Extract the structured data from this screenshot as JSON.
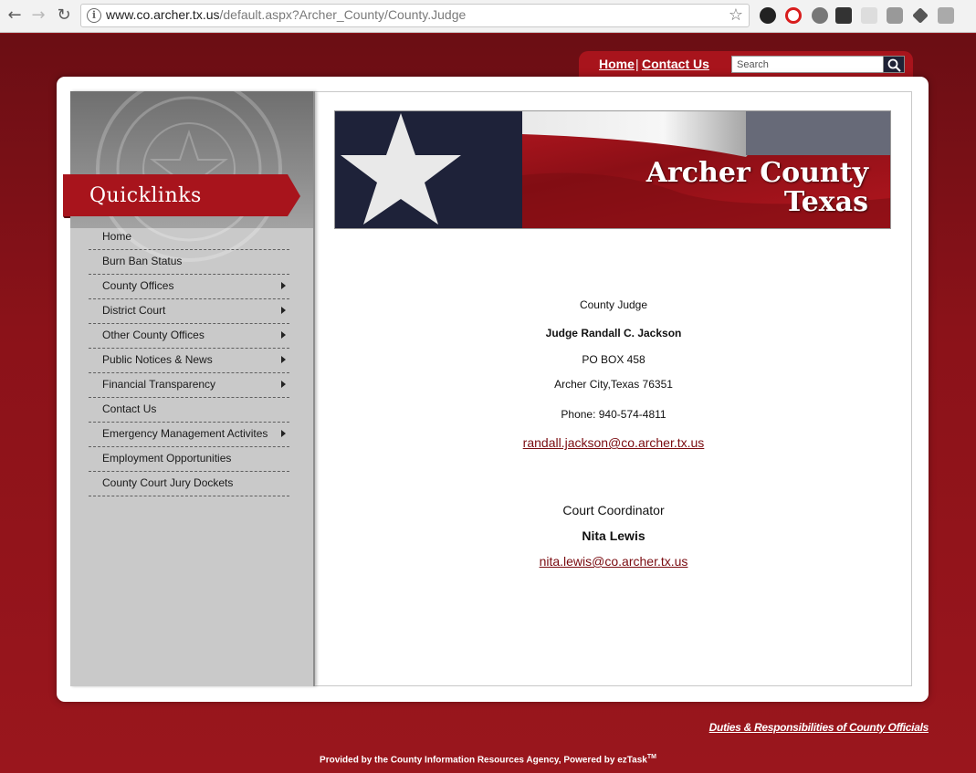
{
  "browser": {
    "url_host": "www.co.archer.tx.us",
    "url_path": "/default.aspx?Archer_County/County.Judge",
    "back_icon": "←",
    "forward_icon": "→",
    "reload_icon": "↻",
    "info_icon": "i",
    "star_icon": "☆"
  },
  "topnav": {
    "home_label": "Home",
    "separator": "|",
    "contact_label": "Contact Us",
    "search_placeholder": "Search"
  },
  "sidebar": {
    "title": "Quicklinks",
    "items": [
      {
        "label": "Home",
        "has_submenu": false
      },
      {
        "label": "Burn Ban Status",
        "has_submenu": false
      },
      {
        "label": "County Offices",
        "has_submenu": true
      },
      {
        "label": "District Court",
        "has_submenu": true
      },
      {
        "label": "Other County Offices",
        "has_submenu": true
      },
      {
        "label": "Public Notices & News",
        "has_submenu": true
      },
      {
        "label": "Financial Transparency",
        "has_submenu": true
      },
      {
        "label": "Contact Us",
        "has_submenu": false
      },
      {
        "label": "Emergency Management Activites",
        "has_submenu": true
      },
      {
        "label": "Employment Opportunities",
        "has_submenu": false
      },
      {
        "label": "County Court Jury Dockets",
        "has_submenu": false
      }
    ]
  },
  "banner": {
    "line1": "Archer County",
    "line2": "Texas"
  },
  "content": {
    "office": "County Judge",
    "name": "Judge Randall C. Jackson",
    "address1": "PO BOX 458",
    "address2": "Archer City,Texas 76351",
    "phone": "Phone: 940-574-4811",
    "email": "randall.jackson@co.archer.tx.us",
    "coord_title": "Court Coordinator",
    "coord_name": "Nita Lewis",
    "coord_email": "nita.lewis@co.archer.tx.us"
  },
  "footer": {
    "duties_link": "Duties & Responsibilities of County Officials",
    "provided_text": "Provided by the County Information Resources Agency, Powered by ezTask",
    "tm": "TM"
  },
  "colors": {
    "brand_red": "#a8141c",
    "background_red": "#8b1219",
    "navy": "#1f2236"
  }
}
